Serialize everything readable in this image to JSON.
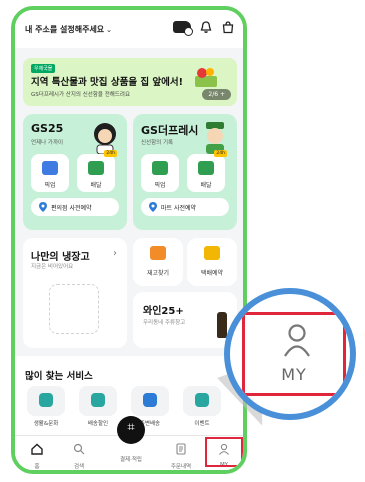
{
  "header": {
    "address_label": "내 주소를 설정해주세요",
    "address_chevron": "⌄"
  },
  "banner": {
    "badge": "우체국몰",
    "title": "지역 특산물과 맛집 상품을 집 앞에서!",
    "subtitle": "GS더프레시가 산지의 신선함을 전해드려요",
    "page_indicator": "2/6 +"
  },
  "stores": [
    {
      "title": "GS25",
      "subtitle": "언제나 가까이",
      "actions": [
        {
          "label": "픽업"
        },
        {
          "label": "배달",
          "tag": "24h"
        }
      ],
      "reserve_label": "편의점 사전예약"
    },
    {
      "title": "GS더프레시",
      "subtitle": "신선함의 기록",
      "actions": [
        {
          "label": "픽업"
        },
        {
          "label": "배달",
          "tag": "24h"
        }
      ],
      "reserve_label": "마트 사전예약"
    }
  ],
  "fridge": {
    "title": "나만의 냉장고",
    "arrow": "›",
    "subtitle": "지금은 비어있어요"
  },
  "quick": [
    {
      "label": "재고찾기"
    },
    {
      "label": "택배예약"
    }
  ],
  "wine": {
    "title": "와인25+",
    "subtitle": "우리동네 주류창고"
  },
  "services": {
    "title": "많이 찾는 서비스",
    "items": [
      {
        "label": "생활&문화"
      },
      {
        "label": "배송할인"
      },
      {
        "label": "주변배송"
      },
      {
        "label": "이벤트"
      }
    ]
  },
  "tabbar": {
    "tabs": [
      {
        "label": "홈"
      },
      {
        "label": "검색"
      },
      {
        "label": "결제·적립"
      },
      {
        "label": "주문내역"
      },
      {
        "label": "MY"
      }
    ]
  },
  "magnifier": {
    "label": "MY"
  },
  "colors": {
    "brand_green": "#5fcf5f",
    "card_mint": "#c6f0d8",
    "highlight_red": "#e0263a",
    "magnifier_ring": "#4a90d9"
  }
}
